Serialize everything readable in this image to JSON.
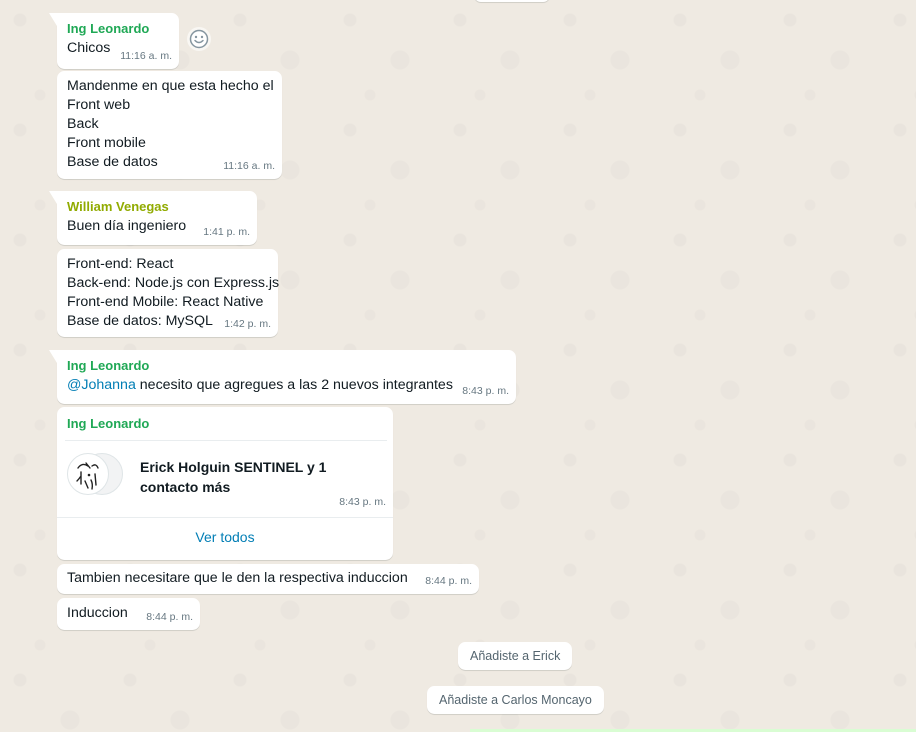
{
  "messages": {
    "m1": {
      "sender": "Ing Leonardo",
      "text": "Chicos",
      "time": "11:16 a. m."
    },
    "m2": {
      "lines": [
        "Mandenme en que esta hecho el",
        "Front web",
        "Back",
        "Front mobile",
        "Base de datos"
      ],
      "time": "11:16 a. m."
    },
    "m3": {
      "sender": "William Venegas",
      "text": "Buen día ingeniero",
      "time": "1:41 p. m."
    },
    "m4": {
      "lines": [
        "Front-end: React",
        "Back-end: Node.js con Express.js",
        "Front-end Mobile: React Native",
        "Base de datos: MySQL"
      ],
      "time": "1:42 p. m."
    },
    "m5": {
      "sender": "Ing Leonardo",
      "mention": "@Johanna",
      "text": " necesito que agregues a las 2 nuevos integrantes",
      "time": "8:43 p. m."
    },
    "m6": {
      "sender": "Ing Leonardo",
      "contact_name": "Erick Holguin SENTINEL y 1 contacto más",
      "time": "8:43 p. m.",
      "see_all": "Ver todos"
    },
    "m7": {
      "text": "Tambien necesitare que le den la respectiva induccion",
      "time": "8:44 p. m."
    },
    "m8": {
      "text": "Induccion",
      "time": "8:44 p. m."
    }
  },
  "system": {
    "added_erick": "Añadiste a Erick",
    "added_carlos": "Añadiste a Carlos Moncayo"
  },
  "icons": {
    "reaction": "emoji-smile-icon",
    "contact_avatar": "sketch-avatar-icon"
  },
  "colors": {
    "background": "#efeae2",
    "bubble": "#ffffff",
    "sender_leonardo": "#1fa855",
    "sender_william": "#91ab01",
    "link": "#027eb5",
    "timestamp": "#667781"
  }
}
